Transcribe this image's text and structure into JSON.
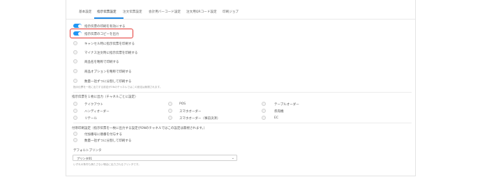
{
  "tabs": [
    {
      "label": "基本設定"
    },
    {
      "label": "指示伝票設定"
    },
    {
      "label": "注文伝票設定"
    },
    {
      "label": "会計用バーコード設定"
    },
    {
      "label": "注文用QRコード設定"
    },
    {
      "label": "印刷ジョブ"
    }
  ],
  "active_tab": "指示伝票設定",
  "toggles": [
    {
      "label": "指示伝票の印刷を有効にする",
      "on": true
    },
    {
      "label": "指示伝票のコピーを出力",
      "on": true
    }
  ],
  "options": [
    {
      "label": "キャンセル時に指示伝票を印刷する"
    },
    {
      "label": "マイナス注文時に指示伝票を印刷する"
    },
    {
      "label": "商品名を略称で印刷する"
    },
    {
      "label": "商品オプションを略称で印刷する"
    },
    {
      "label": "数量一括ずつに分割して印刷する"
    }
  ],
  "option_note": "指示伝票を一枚に出力する設定がONのチャネルではこの設定は無視されます。",
  "channel_section": {
    "heading": "指示伝票を１枚に出力（チャネルごとに設定）",
    "items": [
      "テイクアウト",
      "POS",
      "テーブルオーダー",
      "ハンディオーダー",
      "スマホオーダー",
      "券売機",
      "リテール",
      "スマホオーダー（事前決済）",
      "EC"
    ]
  },
  "addon_section": {
    "heading": "付帯印刷設定（指示伝票を一枚に出力する設定がONのチャネルではこの設定は無視されます。）",
    "items": [
      "付加番号に順番を付与する",
      "数量一括ずつに分割して印刷する"
    ]
  },
  "printer": {
    "label": "デフォルトプリンタ",
    "selected": "プリンタ01",
    "help": "いずれの条件も満たさない場合に出力されるプリンタです。"
  },
  "colors": {
    "accent": "#2196f3",
    "highlight": "#e53935"
  }
}
